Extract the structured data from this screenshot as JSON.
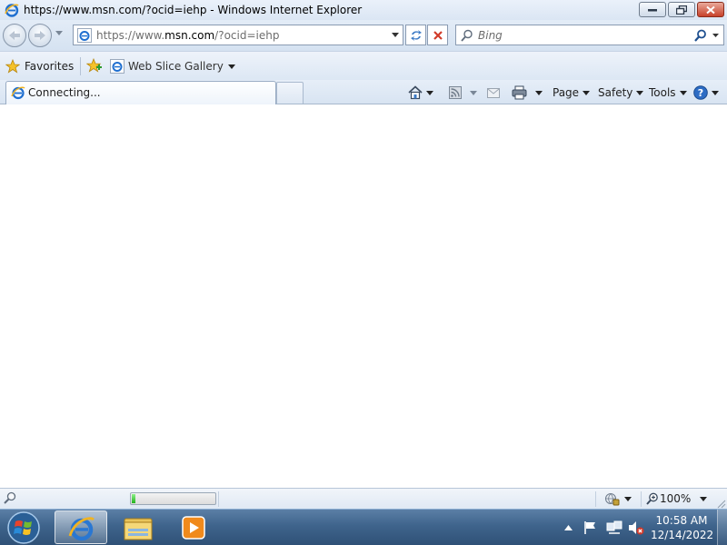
{
  "window": {
    "title": "https://www.msn.com/?ocid=iehp - Windows Internet Explorer"
  },
  "address_bar": {
    "url_scheme": "https://www.",
    "url_host": "msn.com",
    "url_path": "/?ocid=iehp"
  },
  "search": {
    "placeholder": "Bing"
  },
  "favorites_bar": {
    "favorites_label": "Favorites",
    "web_slice_label": "Web Slice Gallery"
  },
  "tab": {
    "title": "Connecting..."
  },
  "command_bar": {
    "page_label": "Page",
    "safety_label": "Safety",
    "tools_label": "Tools"
  },
  "status_bar": {
    "zoom": "100%",
    "progress_fraction": 0.05
  },
  "taskbar": {
    "time": "10:58 AM",
    "date": "12/14/2022"
  },
  "icons": {
    "browser": "ie-icon",
    "back": "back-arrow-icon",
    "forward": "forward-arrow-icon",
    "refresh": "refresh-icon",
    "stop": "stop-x-icon",
    "search": "magnifier-icon",
    "favorites": "star-icon",
    "home": "home-icon",
    "feeds": "rss-icon",
    "mail": "mail-icon",
    "print": "printer-icon",
    "help": "help-icon"
  },
  "colors": {
    "chrome_light": "#e3ecf7",
    "taskbar_blue": "#3f648c",
    "close_red": "#c7402a",
    "progress_green": "#22b31d"
  }
}
